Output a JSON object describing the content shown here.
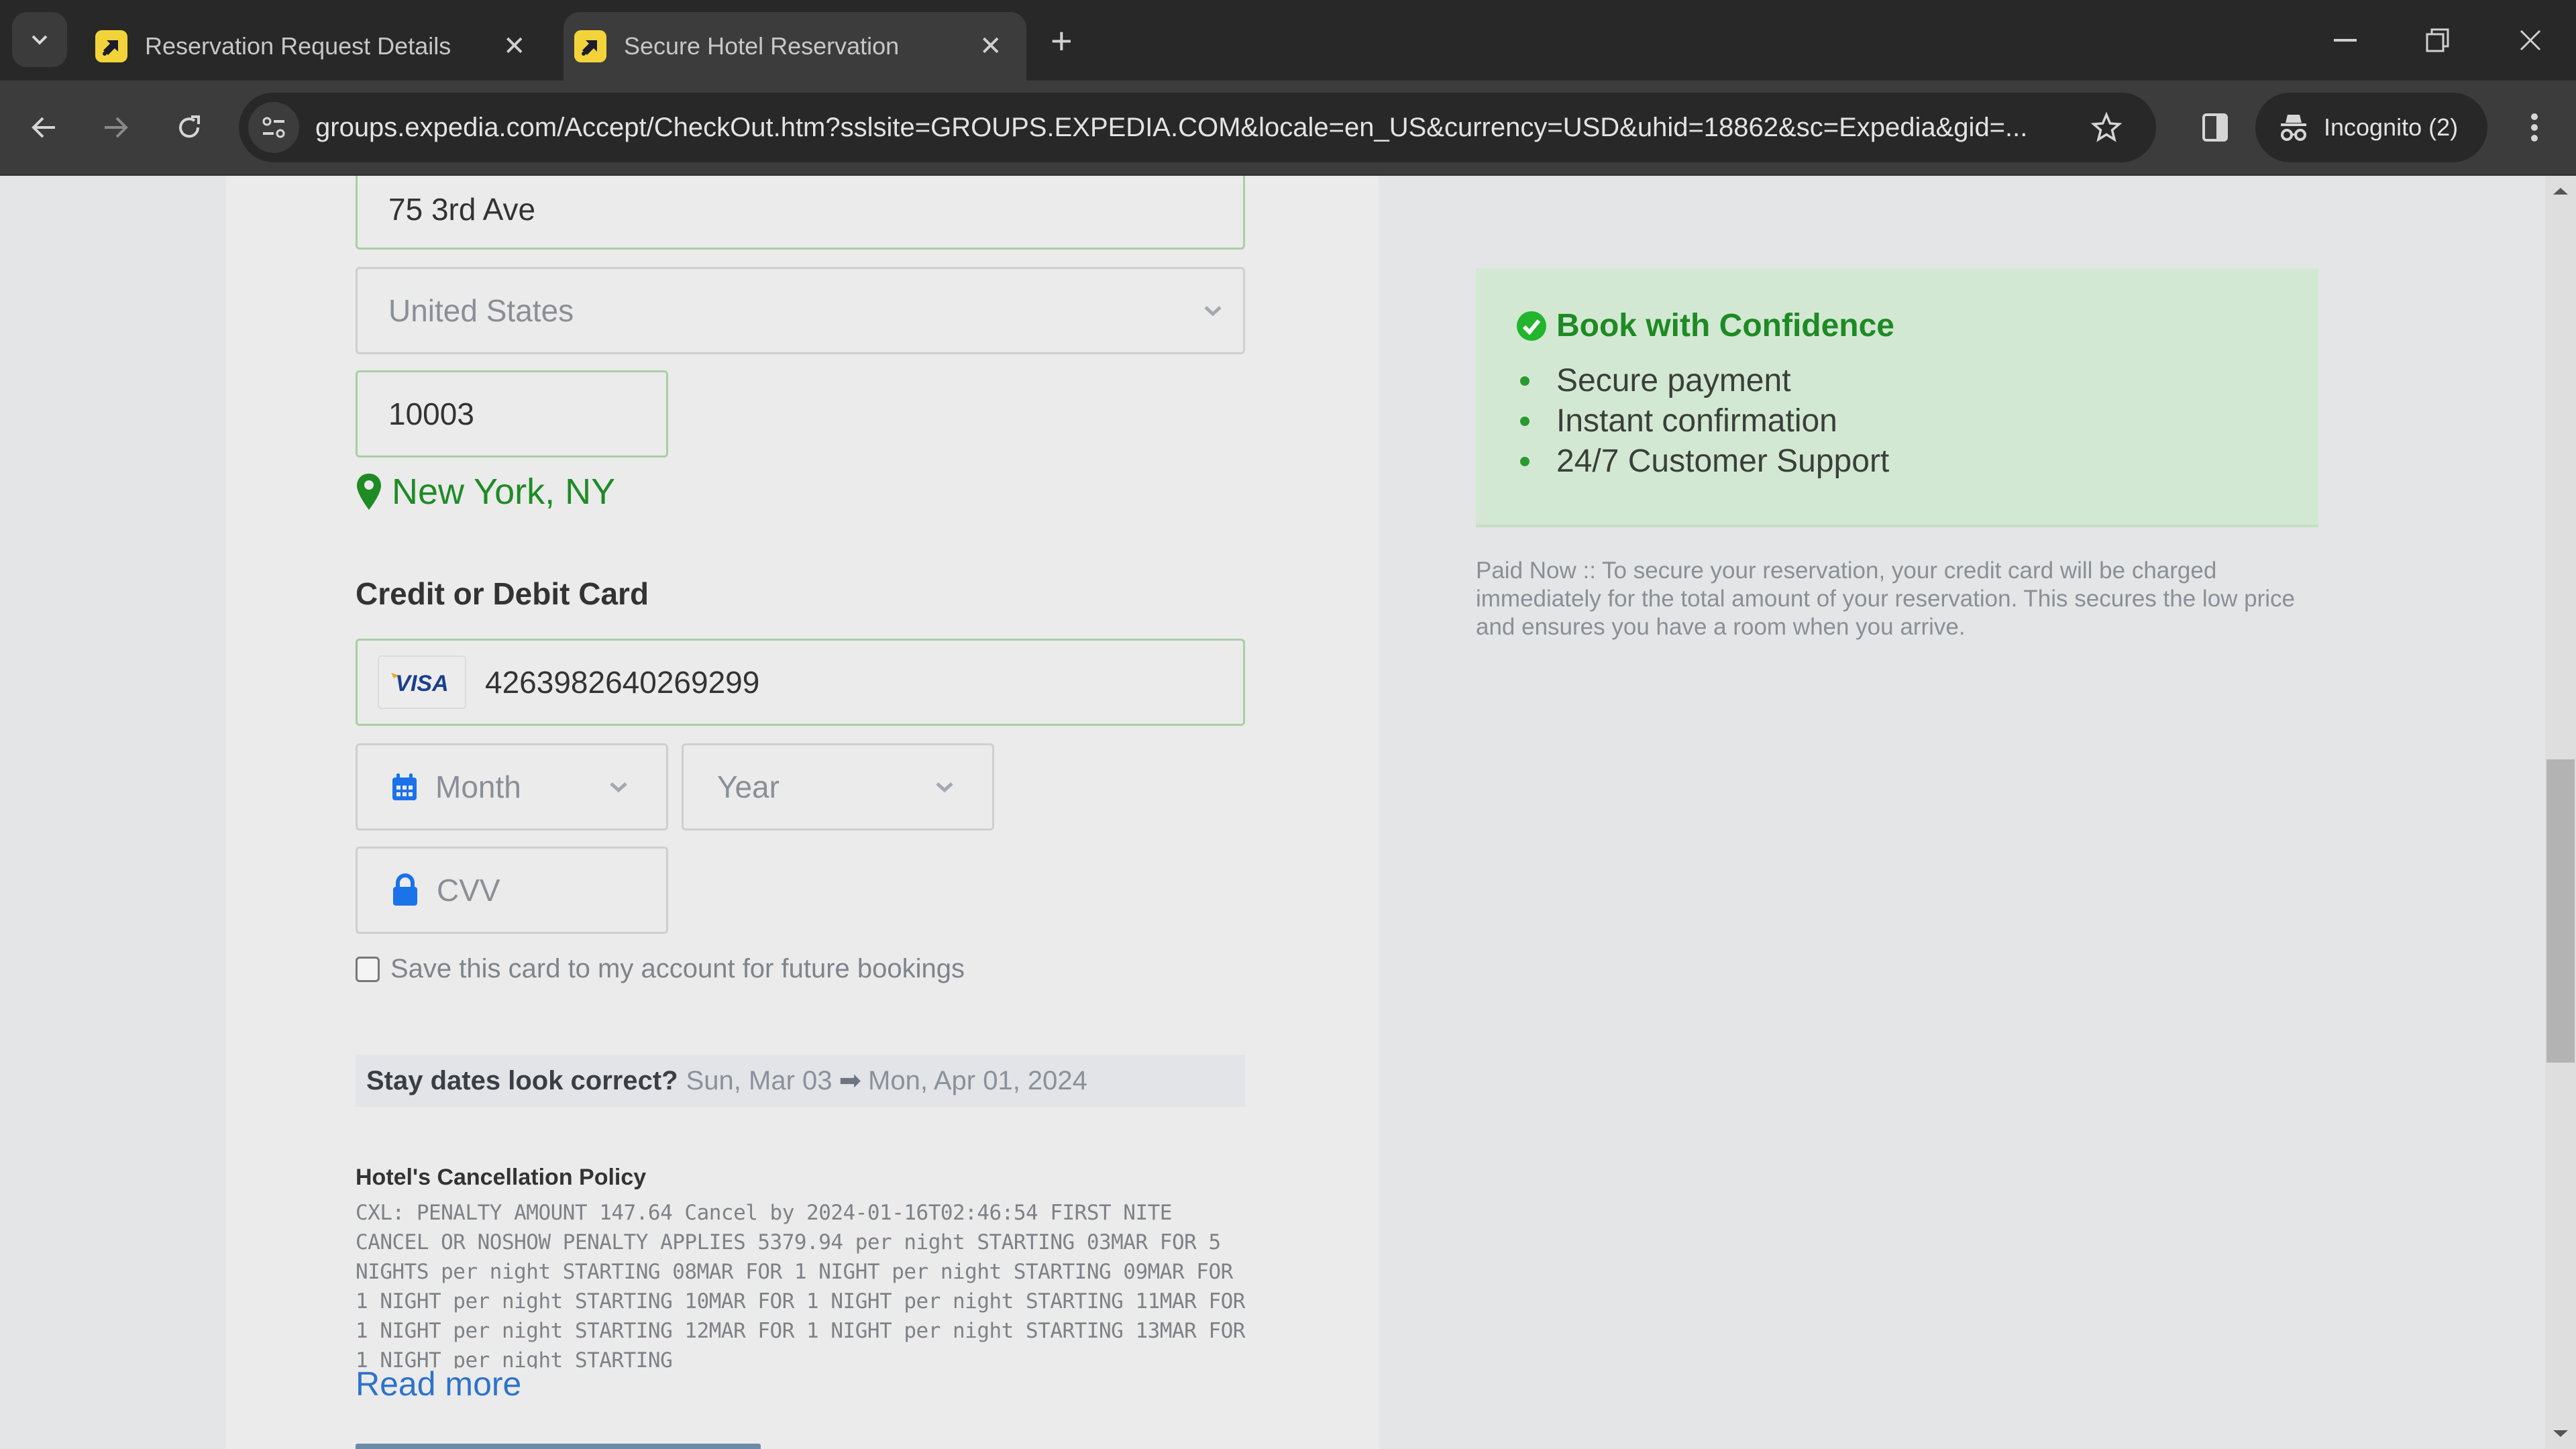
{
  "browser": {
    "tabs": [
      {
        "title": "Reservation Request Details",
        "active": false
      },
      {
        "title": "Secure Hotel Reservation",
        "active": true
      }
    ],
    "url": "groups.expedia.com/Accept/CheckOut.htm?sslsite=GROUPS.EXPEDIA.COM&locale=en_US&currency=USD&uhid=18862&sc=Expedia&gid=...",
    "incognito_label": "Incognito (2)"
  },
  "address": {
    "street_value": "75 3rd Ave",
    "country_value": "United States",
    "zip_value": "10003",
    "location_text": "New York, NY"
  },
  "payment": {
    "section_title": "Credit or Debit Card",
    "card_brand": "VISA",
    "card_number": "4263982640269299",
    "month_placeholder": "Month",
    "year_placeholder": "Year",
    "cvv_placeholder": "CVV",
    "save_card_label": "Save this card to my account for future bookings",
    "save_card_checked": false
  },
  "stay": {
    "question": "Stay dates look correct?",
    "checkin": "Sun, Mar 03",
    "arrow": "➡",
    "checkout": "Mon, Apr 01, 2024"
  },
  "cancellation": {
    "title": "Hotel's Cancellation Policy",
    "text": "CXL: PENALTY AMOUNT 147.64 Cancel by 2024-01-16T02:46:54 FIRST NITE CANCEL OR NOSHOW PENALTY APPLIES 5379.94 per night STARTING 03MAR FOR 5 NIGHTS per night STARTING 08MAR FOR 1 NIGHT per night STARTING 09MAR FOR 1 NIGHT per night STARTING 10MAR FOR 1 NIGHT per night STARTING 11MAR FOR 1 NIGHT per night STARTING 12MAR FOR 1 NIGHT per night STARTING 13MAR FOR 1 NIGHT per night STARTING",
    "read_more": "Read more"
  },
  "confidence": {
    "title": "Book with Confidence",
    "items": [
      "Secure payment",
      "Instant confirmation",
      "24/7 Customer Support"
    ],
    "accent_color": "#1e8a25"
  },
  "paid_now_text": "Paid Now :: To secure your reservation, your credit card will be charged immediately for the total amount of your reservation. This secures the low price and ensures you have a room when you arrive.",
  "colors": {
    "valid_border": "#a9cfa5",
    "link": "#2d73c9",
    "icon_blue": "#1a73e8",
    "favicon_yellow": "#f2d43a"
  }
}
